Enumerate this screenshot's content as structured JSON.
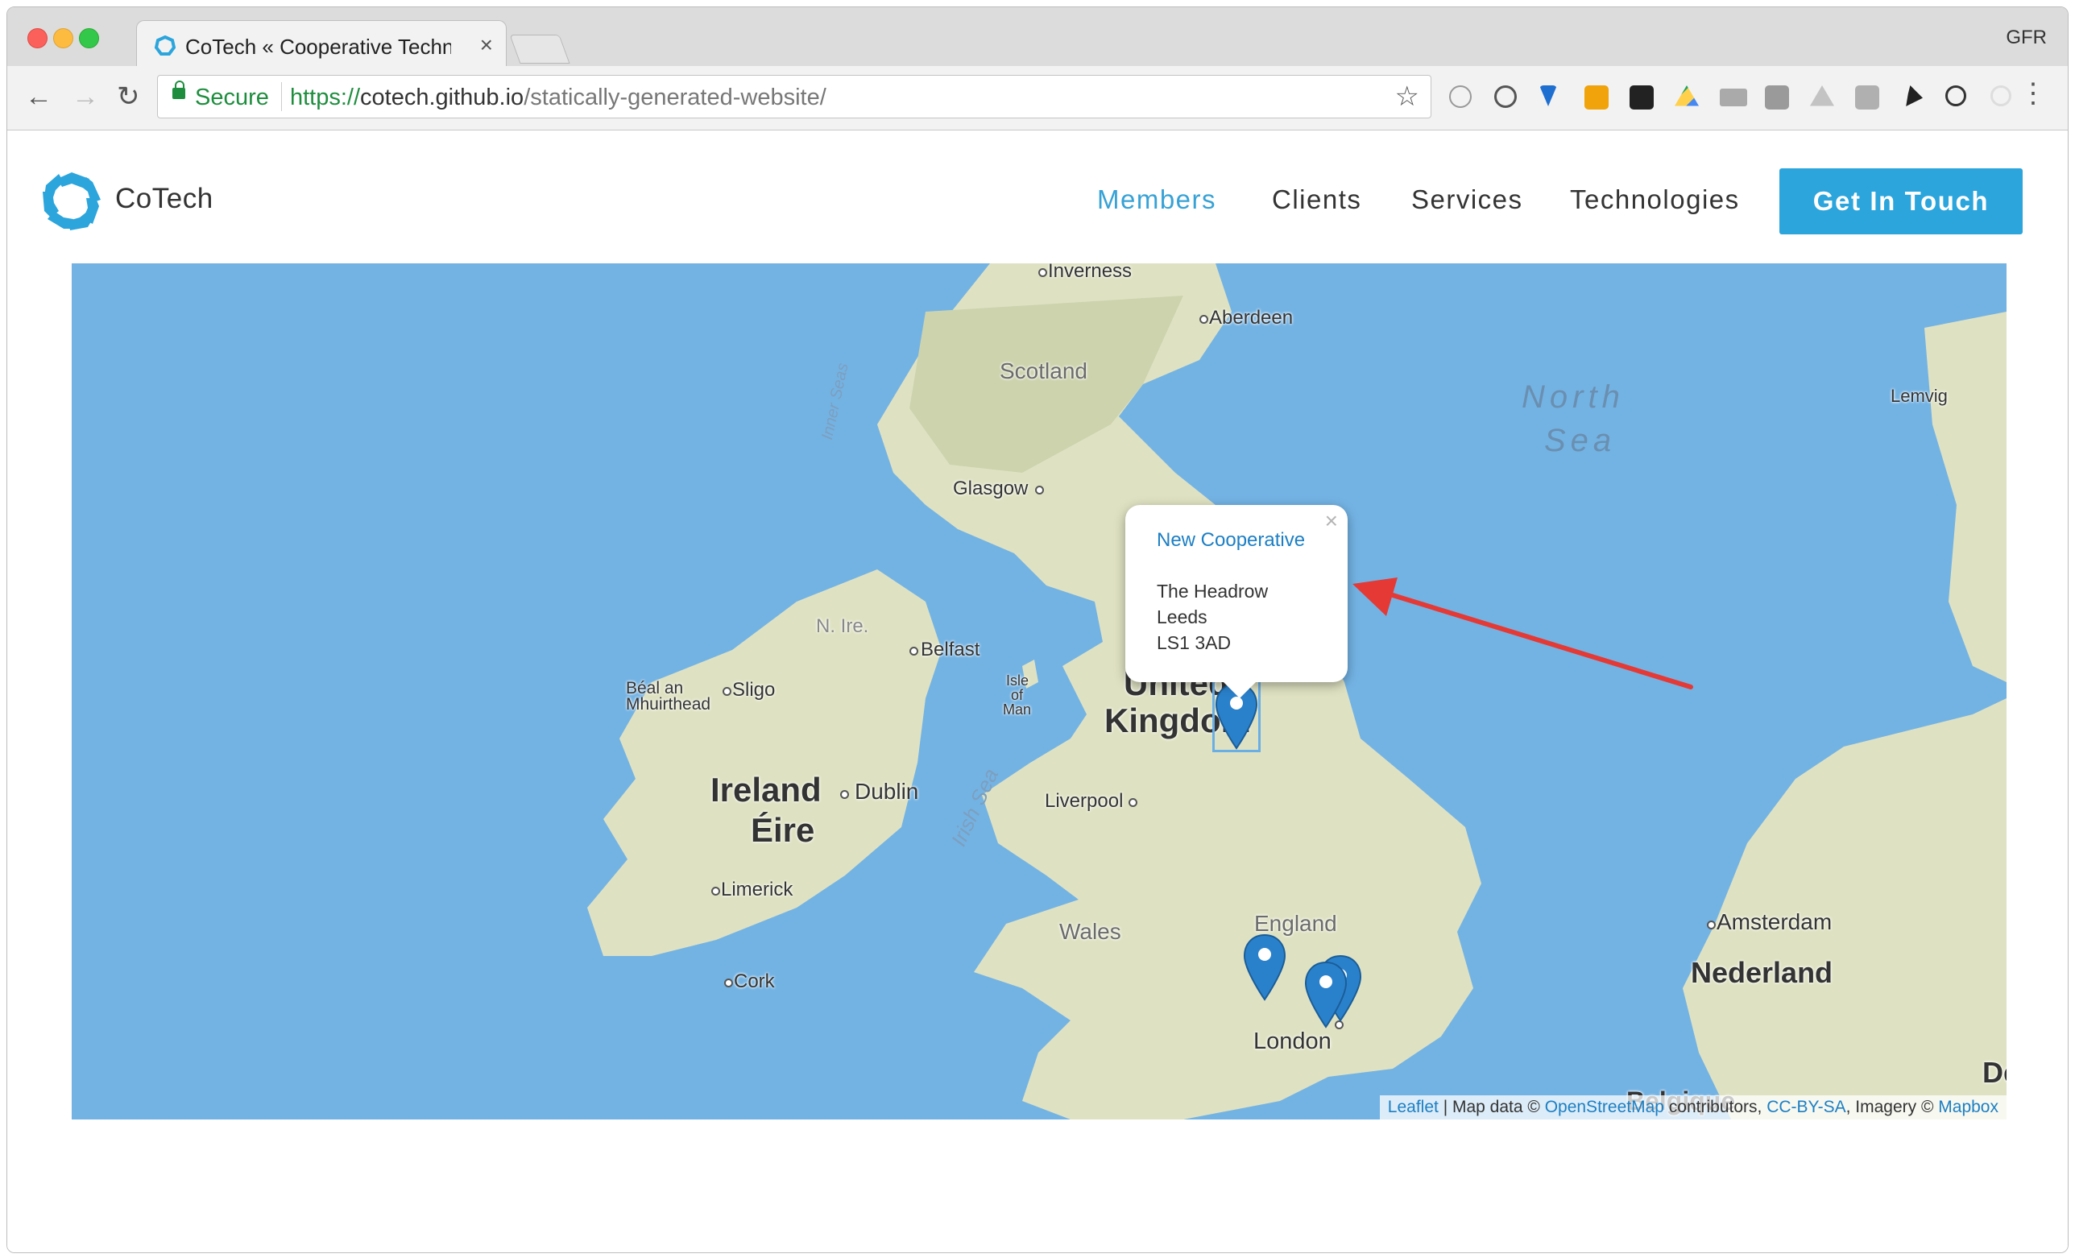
{
  "browser": {
    "tab_title": "CoTech « Cooperative Technol",
    "url_scheme": "https://",
    "url_host": "cotech.github.io",
    "url_path": "/statically-generated-website/",
    "secure_label": "Secure",
    "profile": "GFR"
  },
  "header": {
    "brand": "CoTech",
    "nav": [
      "Members",
      "Clients",
      "Services",
      "Technologies"
    ],
    "cta": "Get In Touch"
  },
  "map": {
    "places": {
      "inverness": "Inverness",
      "aberdeen": "Aberdeen",
      "scotland": "Scotland",
      "glasgow": "Glasgow",
      "belfast": "Belfast",
      "n_ire": "N. Ire.",
      "beal_an": "Béal an",
      "mhuirthead": "Mhuirthead",
      "sligo": "Sligo",
      "isle": "Isle",
      "of": "of",
      "man": "Man",
      "ireland": "Ireland",
      "eire": "Éire",
      "dublin": "Dublin",
      "limerick": "Limerick",
      "cork": "Cork",
      "irish_sea": "Irish Sea",
      "inner_seas": "Inner Seas",
      "liverpool": "Liverpool",
      "wales": "Wales",
      "england": "England",
      "london": "London",
      "united": "United",
      "kingdom": "Kingdom",
      "north": "North",
      "sea": "Sea",
      "lemvig": "Lemvig",
      "amsterdam": "Amsterdam",
      "nederland": "Nederland",
      "belgique": "Belgique",
      "de": "De"
    },
    "popup": {
      "title": "New Cooperative",
      "address_1": "The Headrow",
      "address_2": "Leeds",
      "address_3": "LS1 3AD",
      "close": "×"
    },
    "attribution": {
      "leaflet": "Leaflet",
      "sep1": " | Map data © ",
      "osm": "OpenStreetMap",
      "contributors": " contributors, ",
      "license": "CC-BY-SA",
      "imagery": ", Imagery © ",
      "mapbox": "Mapbox"
    }
  },
  "colors": {
    "accent": "#2ba5dc",
    "nav_active": "#37a2d5",
    "water": "#73b3e4",
    "land": "#dfe2c2",
    "marker": "#2a81cb",
    "arrow": "#e53935"
  }
}
